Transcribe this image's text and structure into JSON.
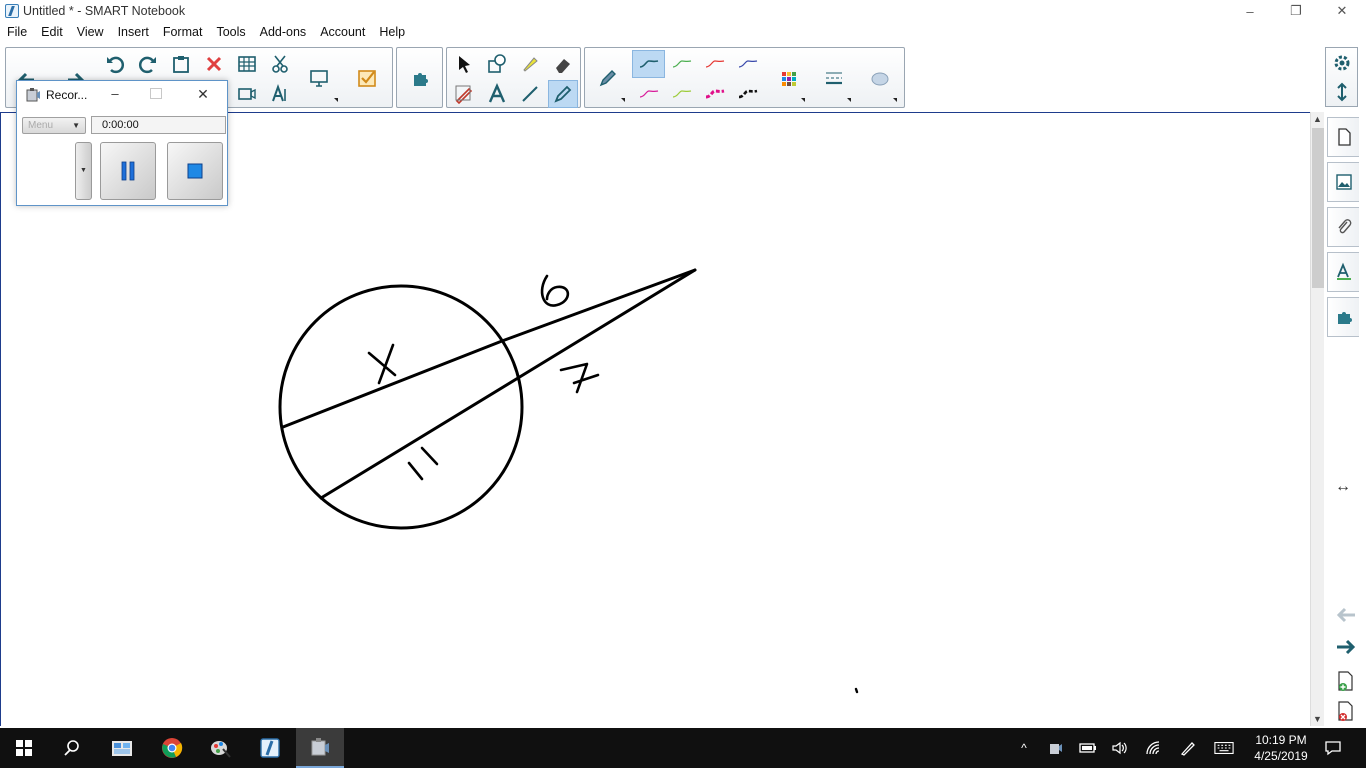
{
  "window": {
    "title": "Untitled * - SMART Notebook",
    "minimize": "–",
    "restore": "❐",
    "close": "✕"
  },
  "menu": {
    "items": [
      "File",
      "Edit",
      "View",
      "Insert",
      "Format",
      "Tools",
      "Add-ons",
      "Account",
      "Help"
    ]
  },
  "recorder": {
    "title": "Recor...",
    "menu_label": "Menu",
    "time": "0:00:00",
    "minimize": "–",
    "close": "✕"
  },
  "drawing": {
    "labels": {
      "x": "x",
      "six": "6",
      "seven": "7",
      "eleven": "11"
    },
    "stroke_color": "#000000"
  },
  "taskbar": {
    "time": "10:19 PM",
    "date": "4/25/2019"
  },
  "colors": {
    "accent": "#1e3c8c",
    "pen_green": "#4caf50",
    "pen_red": "#e53935",
    "pen_blue": "#3949ab",
    "pen_magenta": "#d81b9a",
    "selected_bg": "#bcd9f3"
  }
}
